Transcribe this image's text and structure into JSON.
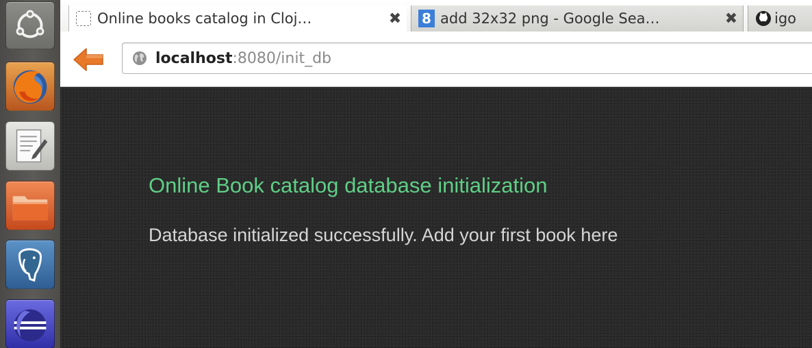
{
  "browser": {
    "tabs": [
      {
        "title": "Online books catalog in Cloj…",
        "active": true,
        "favicon": "blank-page-icon"
      },
      {
        "title": "add 32x32 png - Google Sea…",
        "active": false,
        "favicon": "google-icon",
        "favicon_text": "8"
      },
      {
        "title": "igo",
        "active": false,
        "favicon": "github-icon"
      }
    ],
    "close_glyph": "✖",
    "address": {
      "host": "localhost",
      "rest": ":8080/init_db"
    }
  },
  "page": {
    "heading": "Online Book catalog database initialization",
    "message": "Database initialized successfully. Add your first book here"
  },
  "launcher": {
    "items": [
      "ubuntu-dash-icon",
      "firefox-icon",
      "text-editor-icon",
      "files-icon",
      "postgresql-icon",
      "eclipse-icon"
    ]
  },
  "colors": {
    "heading": "#5fcf86",
    "message": "#d6d6d6",
    "page_background": "#2a2a2a",
    "back_arrow": "#e8782a"
  }
}
